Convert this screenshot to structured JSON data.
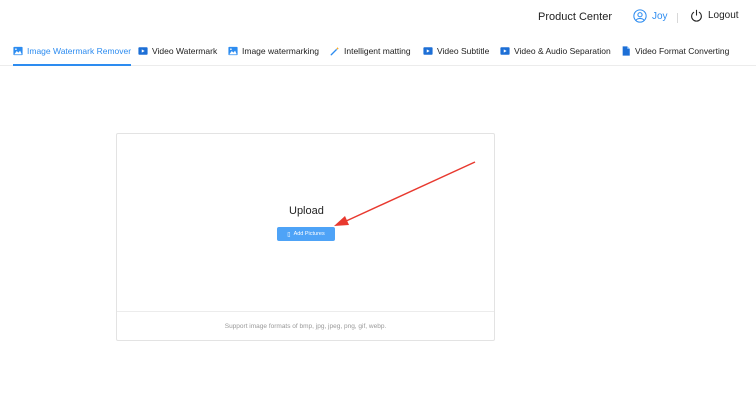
{
  "header": {
    "product_center": "Product Center",
    "user_name": "Joy",
    "logout_label": "Logout"
  },
  "tabs": [
    {
      "label": "Image Watermark Remover",
      "icon": "image-icon",
      "active": true
    },
    {
      "label": "Video Watermark",
      "icon": "video-icon",
      "active": false
    },
    {
      "label": "Image watermarking",
      "icon": "image-icon",
      "active": false
    },
    {
      "label": "Intelligent matting",
      "icon": "magic-wand-icon",
      "active": false
    },
    {
      "label": "Video Subtitle",
      "icon": "video-icon",
      "active": false
    },
    {
      "label": "Video & Audio Separation",
      "icon": "video-icon",
      "active": false
    },
    {
      "label": "Video Format Converting",
      "icon": "file-icon",
      "active": false
    }
  ],
  "upload": {
    "title": "Upload",
    "button_label": "Add Pictures",
    "support_text": "Support image formats of bmp, jpg, jpeg, png, gif, webp."
  },
  "colors": {
    "accent": "#2d8cf0",
    "button": "#4ea3f7",
    "annotation_arrow": "#e8392f"
  }
}
